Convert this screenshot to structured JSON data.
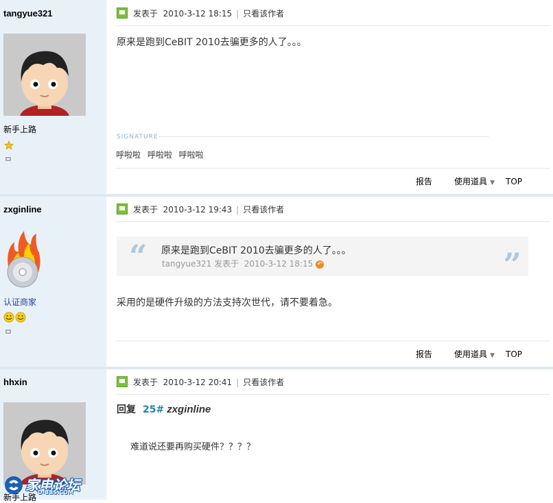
{
  "posts": [
    {
      "author": "tangyue321",
      "rank": "新手上路",
      "meta": {
        "posted_label": "发表于",
        "time": "2010-3-12 18:15",
        "only_author": "只看该作者"
      },
      "content": "原来是跑到CeBIT 2010去骗更多的人了。。。",
      "signature_label": "SIGNATURE",
      "signature": "呼啦啦 呼啦啦 呼啦啦",
      "actions": {
        "report": "报告",
        "tools": "使用道具",
        "top": "TOP"
      }
    },
    {
      "author": "zxginline",
      "rank": "认证商家",
      "meta": {
        "posted_label": "发表于",
        "time": "2010-3-12 19:43",
        "only_author": "只看该作者"
      },
      "quote": {
        "text": "原来是跑到CeBIT 2010去骗更多的人了。。。",
        "author": "tangyue321",
        "posted_label": "发表于",
        "time": "2010-3-12 18:15"
      },
      "content": "采用的是硬件升级的方法支持次世代，请不要着急。",
      "actions": {
        "report": "报告",
        "tools": "使用道具",
        "top": "TOP"
      }
    },
    {
      "author": "hhxin",
      "rank": "新手上路",
      "meta": {
        "posted_label": "发表于",
        "time": "2010-3-12 20:41",
        "only_author": "只看该作者"
      },
      "reply": {
        "label": "回复",
        "floor": "25#",
        "to": "zxginline"
      },
      "content": "难道说还要再购买硬件？？？？"
    }
  ],
  "watermark": {
    "text": "家电论坛",
    "sub": "D-BBS.COM"
  },
  "colors": {
    "sidebar_bg": "#e9f1f8",
    "link": "#2580b4",
    "quote_mark": "#aec8e0"
  }
}
